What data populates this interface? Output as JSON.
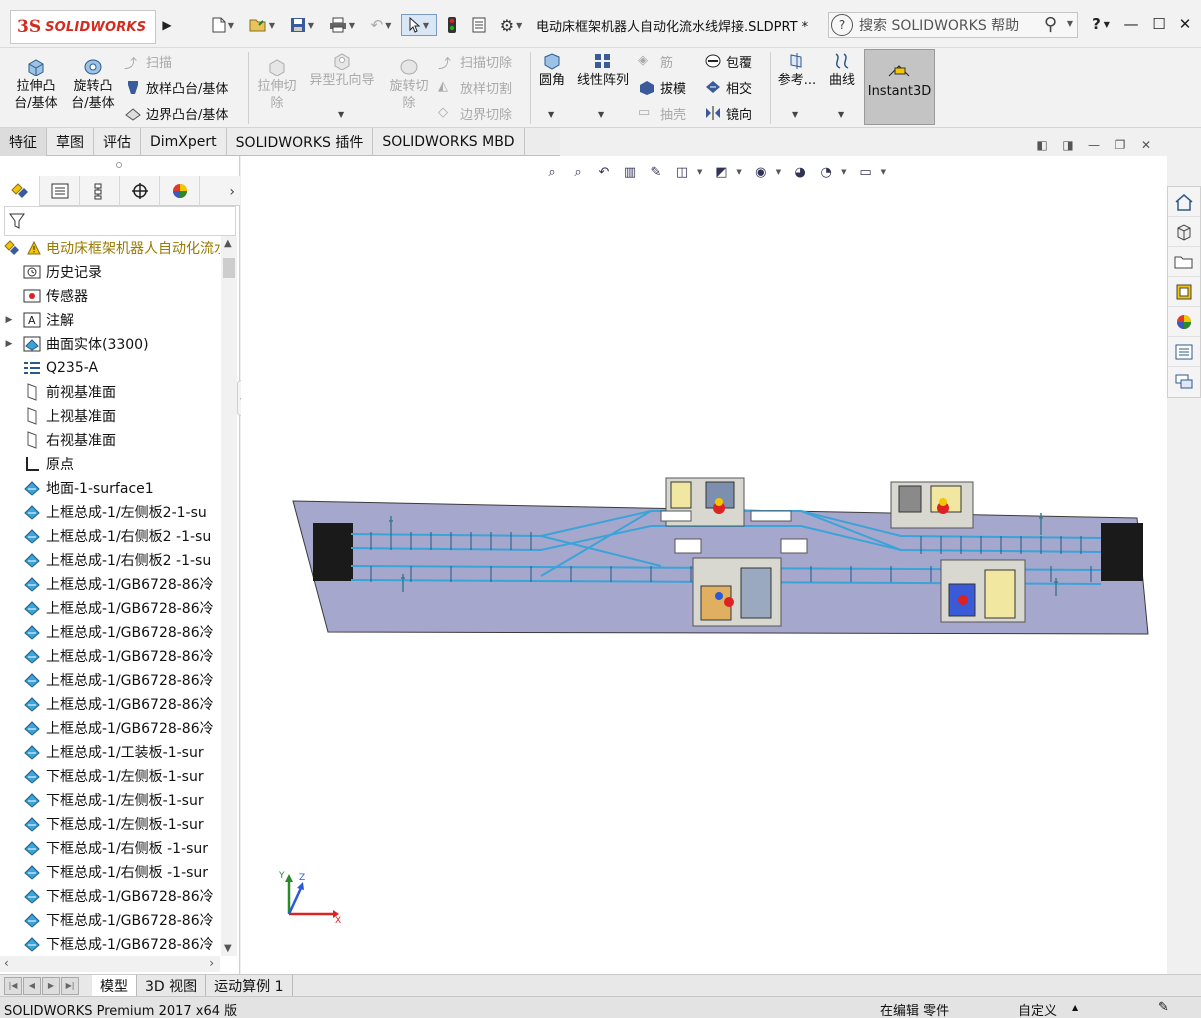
{
  "app": {
    "logo_ds": "3S",
    "logo_text": "SOLIDWORKS",
    "document_title": "电动床框架机器人自动化流水线焊接.SLDPRT *",
    "search_placeholder": "搜索 SOLIDWORKS 帮助",
    "help_label": "?",
    "brand_color": "#d52b1e"
  },
  "ribbon": {
    "extrude_boss": "拉伸凸\n台/基体",
    "revolve_boss": "旋转凸\n台/基体",
    "sweep": "扫描",
    "loft_boss": "放样凸台/基体",
    "boundary_boss": "边界凸台/基体",
    "extrude_cut": "拉伸切\n除",
    "hole_wizard": "异型孔向导",
    "revolve_cut": "旋转切\n除",
    "swept_cut": "扫描切除",
    "lofted_cut": "放样切割",
    "boundary_cut": "边界切除",
    "fillet": "圆角",
    "linear_pattern": "线性阵列",
    "rib": "筋",
    "draft": "拔模",
    "shell": "抽壳",
    "wrap": "包覆",
    "intersect": "相交",
    "mirror": "镜向",
    "reference": "参考...",
    "curves": "曲线",
    "instant3d": "Instant3D"
  },
  "command_tabs": [
    "特征",
    "草图",
    "评估",
    "DimXpert",
    "SOLIDWORKS 插件",
    "SOLIDWORKS MBD"
  ],
  "tree": {
    "root": "电动床框架机器人自动化流水线焊接",
    "items": [
      {
        "label": "历史记录",
        "icon": "history-icon",
        "expandable": false
      },
      {
        "label": "传感器",
        "icon": "sensor-icon",
        "expandable": false
      },
      {
        "label": "注解",
        "icon": "annotation-icon",
        "expandable": true
      },
      {
        "label": "曲面实体(3300)",
        "icon": "surface-bodies-icon",
        "expandable": true
      },
      {
        "label": "Q235-A",
        "icon": "material-icon",
        "expandable": false
      },
      {
        "label": "前视基准面",
        "icon": "plane-icon",
        "expandable": false
      },
      {
        "label": "上视基准面",
        "icon": "plane-icon",
        "expandable": false
      },
      {
        "label": "右视基准面",
        "icon": "plane-icon",
        "expandable": false
      },
      {
        "label": "原点",
        "icon": "origin-icon",
        "expandable": false
      },
      {
        "label": "地面-1-surface1",
        "icon": "surface-icon",
        "expandable": false
      },
      {
        "label": "上框总成-1/左侧板2-1-su",
        "icon": "surface-icon",
        "expandable": false
      },
      {
        "label": "上框总成-1/右侧板2 -1-su",
        "icon": "surface-icon",
        "expandable": false
      },
      {
        "label": "上框总成-1/右侧板2 -1-su",
        "icon": "surface-icon",
        "expandable": false
      },
      {
        "label": "上框总成-1/GB6728-86冷",
        "icon": "surface-icon",
        "expandable": false
      },
      {
        "label": "上框总成-1/GB6728-86冷",
        "icon": "surface-icon",
        "expandable": false
      },
      {
        "label": "上框总成-1/GB6728-86冷",
        "icon": "surface-icon",
        "expandable": false
      },
      {
        "label": "上框总成-1/GB6728-86冷",
        "icon": "surface-icon",
        "expandable": false
      },
      {
        "label": "上框总成-1/GB6728-86冷",
        "icon": "surface-icon",
        "expandable": false
      },
      {
        "label": "上框总成-1/GB6728-86冷",
        "icon": "surface-icon",
        "expandable": false
      },
      {
        "label": "上框总成-1/GB6728-86冷",
        "icon": "surface-icon",
        "expandable": false
      },
      {
        "label": "上框总成-1/工装板-1-sur",
        "icon": "surface-icon",
        "expandable": false
      },
      {
        "label": "下框总成-1/左侧板-1-sur",
        "icon": "surface-icon",
        "expandable": false
      },
      {
        "label": "下框总成-1/左侧板-1-sur",
        "icon": "surface-icon",
        "expandable": false
      },
      {
        "label": "下框总成-1/左侧板-1-sur",
        "icon": "surface-icon",
        "expandable": false
      },
      {
        "label": "下框总成-1/右侧板 -1-sur",
        "icon": "surface-icon",
        "expandable": false
      },
      {
        "label": "下框总成-1/右侧板 -1-sur",
        "icon": "surface-icon",
        "expandable": false
      },
      {
        "label": "下框总成-1/GB6728-86冷",
        "icon": "surface-icon",
        "expandable": false
      },
      {
        "label": "下框总成-1/GB6728-86冷",
        "icon": "surface-icon",
        "expandable": false
      },
      {
        "label": "下框总成-1/GB6728-86冷",
        "icon": "surface-icon",
        "expandable": false
      }
    ]
  },
  "triad": {
    "x": "X",
    "y": "Y",
    "z": "Z"
  },
  "bottom_tabs": [
    "模型",
    "3D 视图",
    "运动算例 1"
  ],
  "status": {
    "product": "SOLIDWORKS Premium 2017 x64 版",
    "mode": "在编辑 零件",
    "units": "自定义"
  }
}
